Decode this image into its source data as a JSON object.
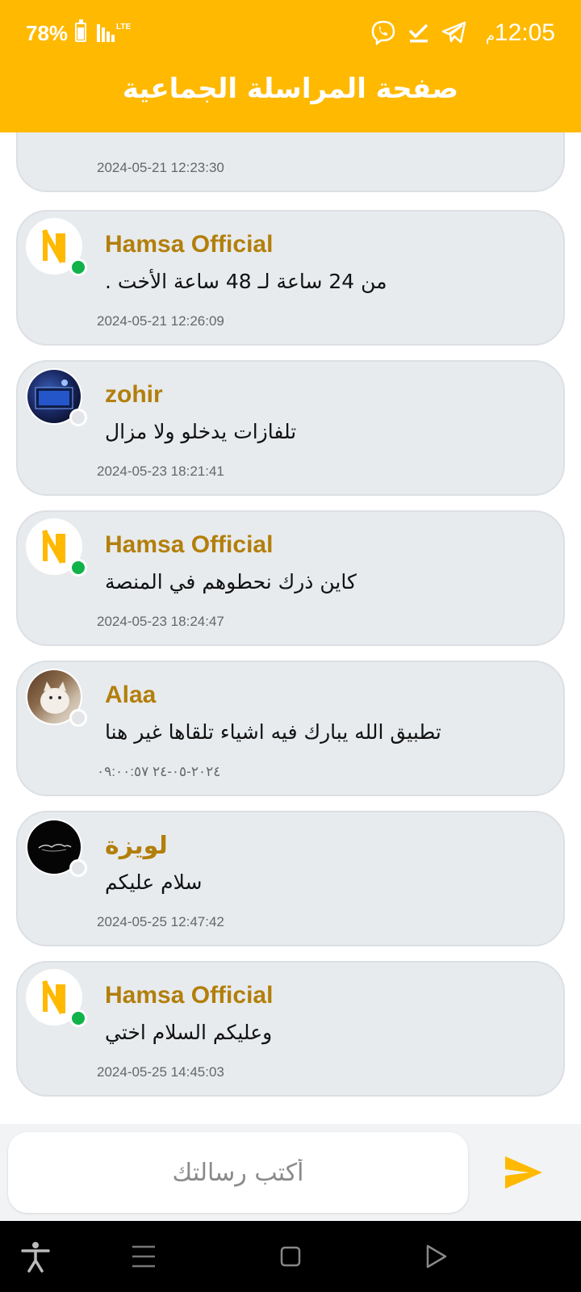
{
  "status_bar": {
    "battery": "78%",
    "network": "LTE",
    "time": "12:05",
    "ampm": "م"
  },
  "header": {
    "title": "صفحة المراسلة الجماعية",
    "color": "#FFB900"
  },
  "partial_message": {
    "time": "2024-05-21 12:23:30"
  },
  "messages": [
    {
      "name": "Hamsa Official",
      "text": "من 24 ساعة لـ 48 ساعة الأخت .",
      "time": "2024-05-21 12:26:09",
      "avatar": "hamsa-logo-icon",
      "online": true
    },
    {
      "name": "zohir",
      "text": "تلفازات يدخلو ولا مزال",
      "time": "2024-05-23 18:21:41",
      "avatar": "user-photo-avatar",
      "online": false
    },
    {
      "name": "Hamsa Official",
      "text": "كاين ذرك نحطوهم في المنصة",
      "time": "2024-05-23 18:24:47",
      "avatar": "hamsa-logo-icon",
      "online": true
    },
    {
      "name": "Alaa",
      "text": "تطبيق الله يبارك فيه اشياء تلقاها غير هنا",
      "time": "٢٠٢٤-٠٥-٢٤ ٠٩:٠٠:٥٧",
      "avatar": "cat-photo-avatar",
      "online": false
    },
    {
      "name": "لويزة",
      "text": "سلام عليكم",
      "time": "2024-05-25 12:47:42",
      "avatar": "dark-photo-avatar",
      "online": false
    },
    {
      "name": "Hamsa Official",
      "text": "وعليكم السلام اختي",
      "time": "2024-05-25 14:45:03",
      "avatar": "hamsa-logo-icon",
      "online": true
    }
  ],
  "composer": {
    "placeholder": "أكتب رسالتك",
    "send_icon": "send-icon"
  },
  "colors": {
    "accent": "#FFB900",
    "name": "#B27F0B",
    "online": "#10b24a",
    "card": "#e8ebee"
  }
}
